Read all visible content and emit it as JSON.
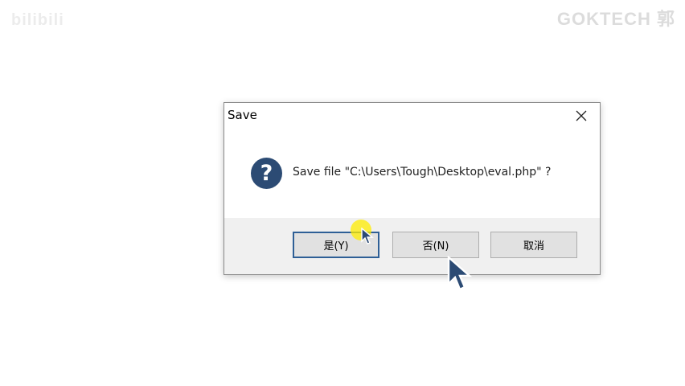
{
  "watermarks": {
    "left": "bilibili",
    "right": "GOKTECH 郭"
  },
  "dialog": {
    "title": "Save",
    "message": "Save file \"C:\\Users\\Tough\\Desktop\\eval.php\" ?",
    "icon": "question-icon",
    "close_icon": "close-icon"
  },
  "buttons": {
    "yes": "是(Y)",
    "no": "否(N)",
    "cancel": "取消"
  },
  "colors": {
    "icon_background": "#2c4b74",
    "default_button_border": "#2e5f96",
    "footer_background": "#f0f0f0",
    "click_highlight": "#ffec00"
  }
}
